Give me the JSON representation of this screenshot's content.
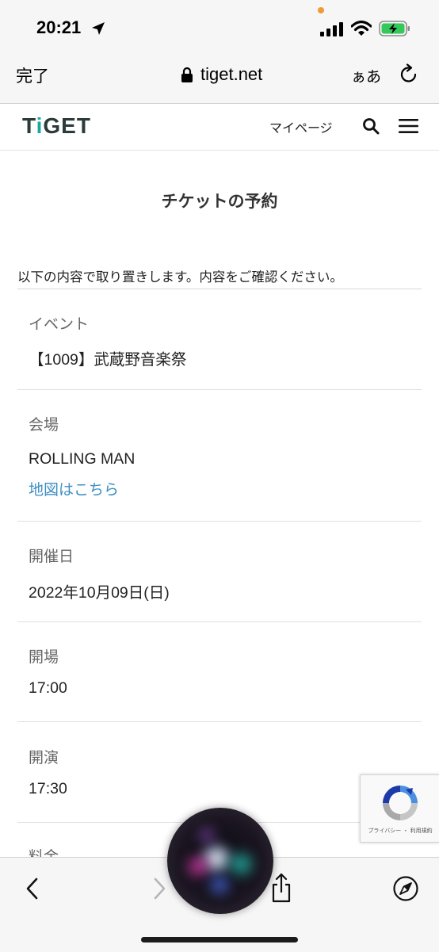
{
  "status_bar": {
    "time": "20:21",
    "icons": [
      "location-arrow-icon",
      "signal-icon",
      "wifi-icon",
      "battery-charging-icon"
    ],
    "battery_color": "#34c759"
  },
  "address_bar": {
    "done_label": "完了",
    "url": "tiget.net",
    "text_size_label": "ぁあ"
  },
  "site_header": {
    "logo": {
      "part1": "T",
      "part2": "i",
      "part3": "GET"
    },
    "mypage_label": "マイページ",
    "accent_color": "#1aa7a0"
  },
  "main": {
    "title": "チケットの予約",
    "intro": "以下の内容で取り置きします。内容をご確認ください。",
    "fields": [
      {
        "label": "イベント",
        "value": "【1009】武蔵野音楽祭"
      },
      {
        "label": "会場",
        "value": "ROLLING MAN",
        "link": "地図はこちら"
      },
      {
        "label": "開催日",
        "value": "2022年10月09日(日)"
      },
      {
        "label": "開場",
        "value": "17:00"
      },
      {
        "label": "開演",
        "value": "17:30"
      },
      {
        "label": "料金"
      }
    ],
    "link_color": "#3d8fc3"
  },
  "recaptcha": {
    "text": "プライバシー ・ 利用規約"
  },
  "toolbar": {
    "icons": [
      "back-icon",
      "forward-icon",
      "share-icon",
      "compass-icon"
    ]
  }
}
